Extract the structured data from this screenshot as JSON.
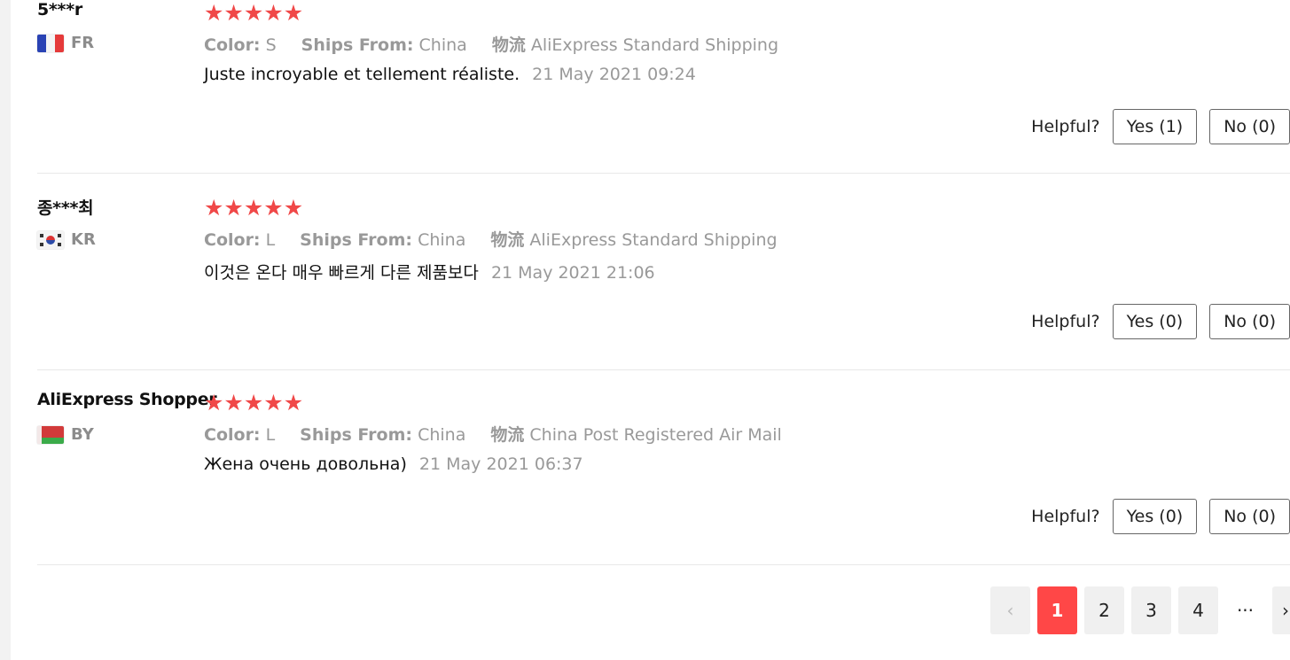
{
  "reviews": [
    {
      "user": "5***r",
      "country": "FR",
      "rating": 5,
      "color_label": "Color:",
      "color_value": "S",
      "ships_label": "Ships From:",
      "ships_value": "China",
      "logistics_label": "物流",
      "logistics_value": "AliExpress Standard Shipping",
      "text": "Juste incroyable et tellement réaliste.",
      "date": "21 May 2021 09:24",
      "helpful_label": "Helpful?",
      "yes": "Yes (1)",
      "no": "No (0)"
    },
    {
      "user": "종***최",
      "country": "KR",
      "rating": 5,
      "color_label": "Color:",
      "color_value": "L",
      "ships_label": "Ships From:",
      "ships_value": "China",
      "logistics_label": "物流",
      "logistics_value": "AliExpress Standard Shipping",
      "text": "이것은 온다 매우 빠르게 다른 제품보다",
      "date": "21 May 2021 21:06",
      "helpful_label": "Helpful?",
      "yes": "Yes (0)",
      "no": "No (0)"
    },
    {
      "user": "AliExpress Shopper",
      "country": "BY",
      "rating": 5,
      "color_label": "Color:",
      "color_value": "L",
      "ships_label": "Ships From:",
      "ships_value": "China",
      "logistics_label": "物流",
      "logistics_value": "China Post Registered Air Mail",
      "text": "Жена очень довольна)",
      "date": "21 May 2021 06:37",
      "helpful_label": "Helpful?",
      "yes": "Yes (0)",
      "no": "No (0)"
    }
  ],
  "icons": {
    "star": "★",
    "prev": "‹",
    "next": "›"
  },
  "pagination": {
    "pages": [
      "1",
      "2",
      "3",
      "4"
    ],
    "current": "1",
    "ellipsis": "···"
  },
  "colors": {
    "star": "#f04848",
    "active_page": "#ff4747"
  }
}
